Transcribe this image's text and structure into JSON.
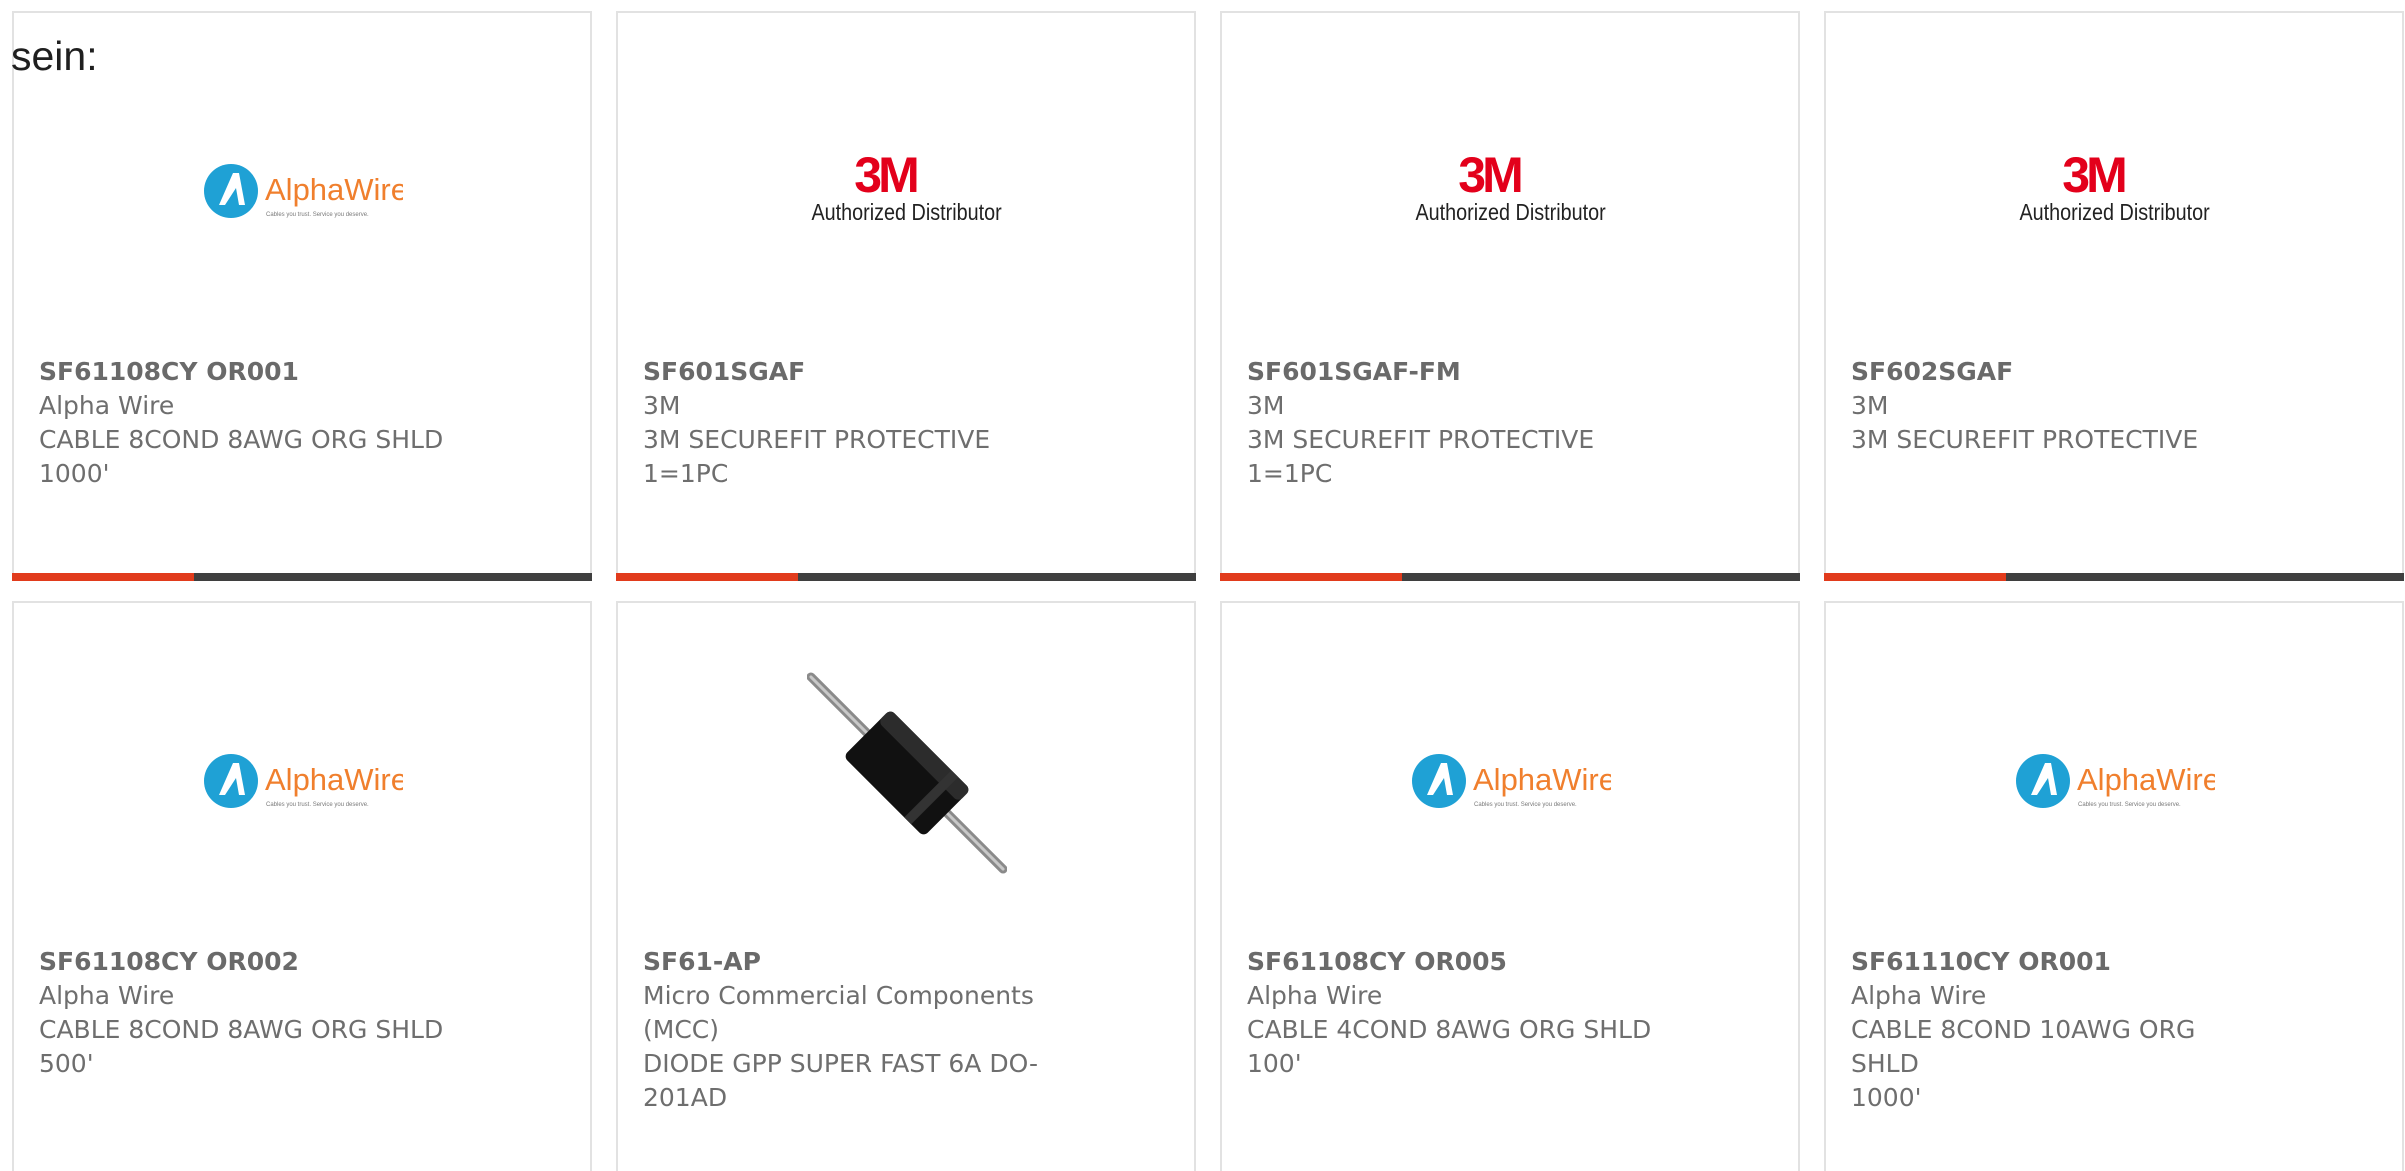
{
  "lead_text": "sein:",
  "logos": {
    "alphawire": {
      "name": "AlphaWire",
      "tagline": "Cables you trust. Service you deserve."
    },
    "threem": {
      "mark": "3M",
      "subtitle": "Authorized Distributor"
    }
  },
  "colors": {
    "accent_bar": "#e13b1c",
    "dark_bar": "#3f3f3f",
    "alphawire_blue": "#1fa1d5",
    "alphawire_orange": "#f07f2d",
    "brand_3m_red": "#e3001b"
  },
  "products": [
    {
      "part": "SF61108CY OR001",
      "manufacturer": "Alpha Wire",
      "desc1": "CABLE 8COND 8AWG ORG SHLD",
      "desc2": "1000'",
      "image_icon": "alphawire-logo"
    },
    {
      "part": "SF601SGAF",
      "manufacturer": "3M",
      "desc1": "3M SECUREFIT PROTECTIVE",
      "desc2": "1=1PC",
      "image_icon": "3m-logo"
    },
    {
      "part": "SF601SGAF-FM",
      "manufacturer": "3M",
      "desc1": "3M SECUREFIT PROTECTIVE",
      "desc2": "1=1PC",
      "image_icon": "3m-logo"
    },
    {
      "part": "SF602SGAF",
      "manufacturer": "3M",
      "desc1": "3M SECUREFIT PROTECTIVE",
      "desc2": "",
      "image_icon": "3m-logo"
    },
    {
      "part": "SF61108CY OR002",
      "manufacturer": "Alpha Wire",
      "desc1": "CABLE 8COND 8AWG ORG SHLD",
      "desc2": "500'",
      "image_icon": "alphawire-logo"
    },
    {
      "part": "SF61-AP",
      "manufacturer": "Micro Commercial Components (MCC)",
      "desc1": "DIODE GPP SUPER FAST 6A DO-201AD",
      "desc2": "",
      "image_icon": "diode-photo"
    },
    {
      "part": "SF61108CY OR005",
      "manufacturer": "Alpha Wire",
      "desc1": "CABLE 4COND 8AWG ORG SHLD",
      "desc2": "100'",
      "image_icon": "alphawire-logo"
    },
    {
      "part": "SF61110CY OR001",
      "manufacturer": "Alpha Wire",
      "desc1": "CABLE 8COND 10AWG ORG SHLD",
      "desc2": "1000'",
      "image_icon": "alphawire-logo"
    }
  ]
}
